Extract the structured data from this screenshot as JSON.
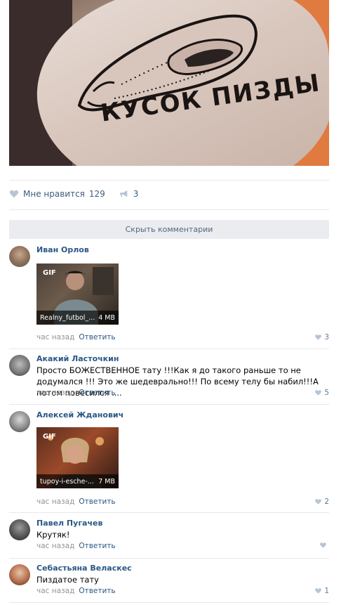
{
  "post": {
    "tattoo_caption": "КУСОК ПИЗДЫ",
    "likes_label": "Мне нравится",
    "likes_count": "129",
    "shares_count": "3"
  },
  "comments_toggle": "Скрыть комментарии",
  "comments": [
    {
      "author": "Иван Орлов",
      "gif": {
        "badge": "GIF",
        "name": "Realny_futbol_...",
        "size": "4 MB"
      },
      "time": "час назад",
      "reply": "Ответить",
      "likes": "3"
    },
    {
      "author": "Акакий Ласточкин",
      "text": "Просто БОЖЕСТВЕННОЕ тату !!!Как я до такого раньше то не додумался !!! Это же шедеврально!!! По всему телу бы набил!!!А потом повесился ....",
      "time": "час назад",
      "reply": "Ответить",
      "likes": "5"
    },
    {
      "author": "Алексей Жданович",
      "gif": {
        "badge": "GIF",
        "name": "tupoy-i-esche-...",
        "size": "7 MB"
      },
      "time": "час назад",
      "reply": "Ответить",
      "likes": "2"
    },
    {
      "author": "Павел Пугачев",
      "text": "Крутяк!",
      "time": "час назад",
      "reply": "Ответить",
      "likes": ""
    },
    {
      "author": "Себастьяна Веласкес",
      "text": "Пиздатое тату",
      "time": "час назад",
      "reply": "Ответить",
      "likes": "1"
    }
  ]
}
